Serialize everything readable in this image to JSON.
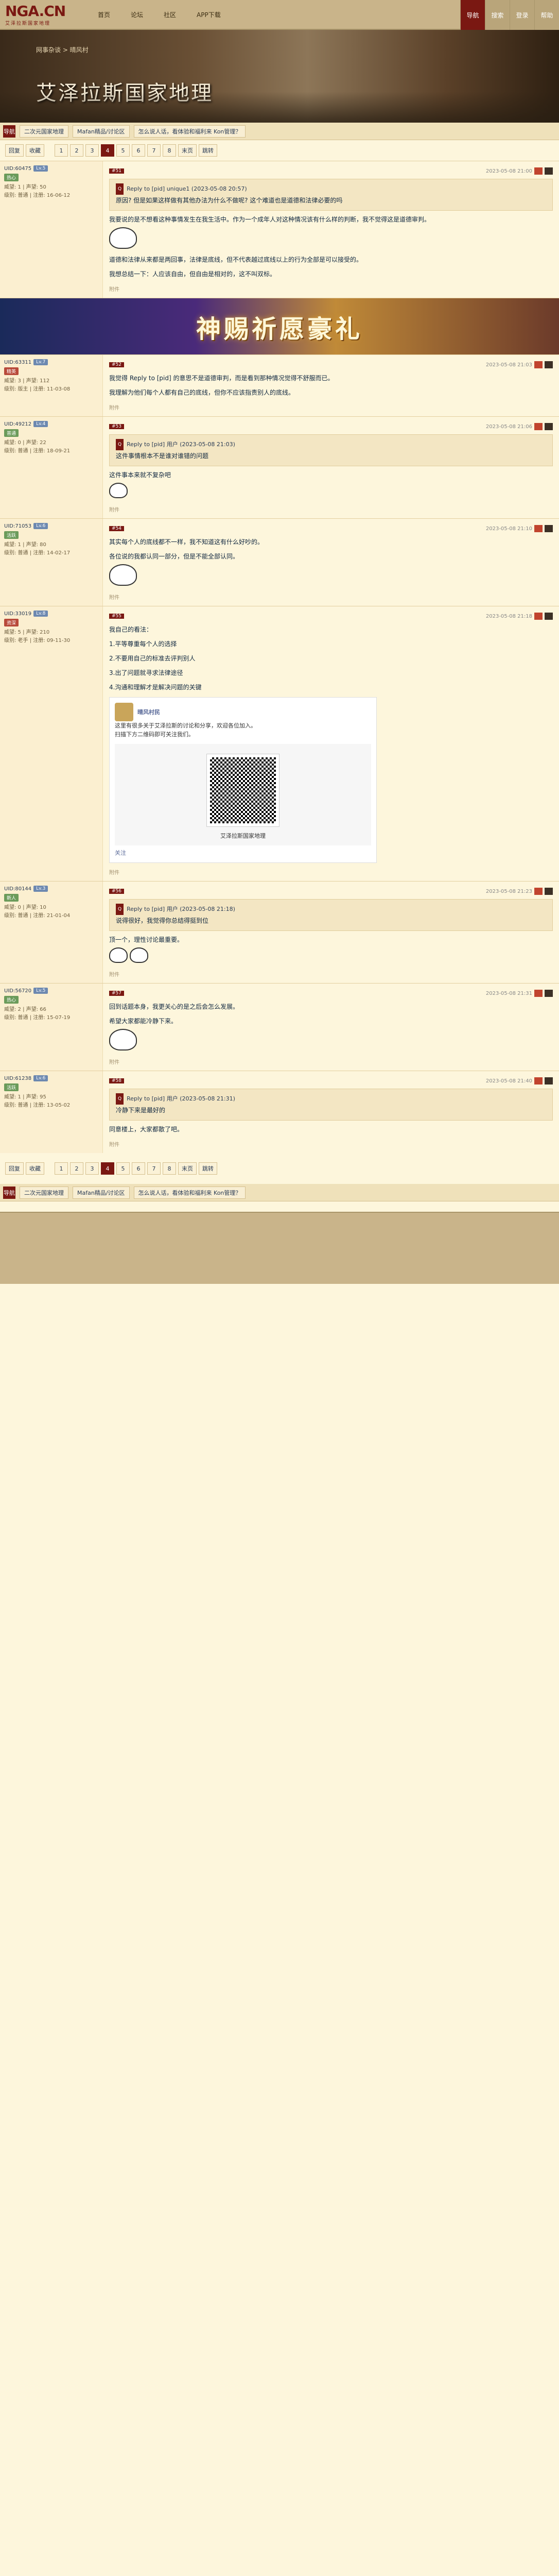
{
  "top": {
    "logo": "NGA.CN",
    "logo_sub": "艾泽拉斯国家地理",
    "nav": [
      "首页",
      "论坛",
      "社区",
      "APP下载"
    ],
    "right": [
      "导航",
      "搜索",
      "登录",
      "帮助"
    ]
  },
  "banner": {
    "title": "艾泽拉斯国家地理",
    "crumb": "网事杂谈 > 晴风村"
  },
  "subnav": {
    "icon": "导航",
    "tags": [
      "二次元国家地理",
      "Mafan精品/讨论区",
      "怎么说人话，看体验和福利来 Kon管理？"
    ]
  },
  "pager": {
    "left": [
      "回复",
      "收藏"
    ],
    "pages": [
      "1",
      "2",
      "3",
      "4",
      "5",
      "6",
      "7",
      "8"
    ],
    "current": "4",
    "right": [
      "末页",
      "跳转"
    ]
  },
  "posts": [
    {
      "uid": "UID:60475",
      "level": "Lv.5",
      "badge": "热心",
      "stats": [
        "威望: 1 | 声望: 50",
        "级别: 普通 | 注册: 16-06-12"
      ],
      "floor": "#51",
      "time": "2023-05-08 21:00",
      "quote_author": "Reply to [pid] unique1 (2023-05-08 20:57)",
      "quote": "原因? 但是如果这样做有其他办法为什么不做呢? 这个难道也是道德和法律必要的吗",
      "text": [
        "我要说的是不想看这种事情发生在我生活中。作为一个成年人对这种情况该有什么样的判断，我不觉得这是道德审判。",
        "道德和法律从来都是两回事，法律是底线，但不代表越过底线以上的行为全部是可以接受的。",
        "我想总结一下：人应该自由，但自由是相对的，这不叫双标。"
      ],
      "tag": "附件"
    },
    {
      "uid": "UID:63311",
      "level": "Lv.7",
      "badge": "精英",
      "stats": [
        "威望: 3 | 声望: 112",
        "级别: 版主 | 注册: 11-03-08"
      ],
      "floor": "#52",
      "time": "2023-05-08 21:03",
      "text": [
        "我觉得 Reply to [pid] 的意思不是道德审判，而是看到那种情况觉得不舒服而已。",
        "我理解为他们每个人都有自己的底线，但你不应该指责别人的底线。"
      ],
      "tag": "附件"
    },
    {
      "uid": "UID:49212",
      "level": "Lv.4",
      "badge": "普通",
      "stats": [
        "威望: 0 | 声望: 22",
        "级别: 普通 | 注册: 18-09-21"
      ],
      "floor": "#53",
      "time": "2023-05-08 21:06",
      "quote_author": "Reply to [pid] 用户 (2023-05-08 21:03)",
      "quote": "这件事情根本不是谁对谁错的问题",
      "text": [
        "这件事本来就不复杂吧"
      ],
      "tag": "附件"
    },
    {
      "uid": "UID:71053",
      "level": "Lv.6",
      "badge": "活跃",
      "stats": [
        "威望: 1 | 声望: 80",
        "级别: 普通 | 注册: 14-02-17"
      ],
      "floor": "#54",
      "time": "2023-05-08 21:10",
      "text": [
        "其实每个人的底线都不一样，我不知道这有什么好吵的。",
        "各位说的我都认同一部分，但是不能全部认同。"
      ],
      "tag": "附件"
    },
    {
      "uid": "UID:33019",
      "level": "Lv.8",
      "badge": "资深",
      "stats": [
        "威望: 5 | 声望: 210",
        "级别: 老手 | 注册: 09-11-30"
      ],
      "floor": "#55",
      "time": "2023-05-08 21:18",
      "text": [
        "我自己的看法：",
        "1.平等尊重每个人的选择",
        "2.不要用自己的标准去评判别人",
        "3.出了问题就寻求法律途径",
        "4.沟通和理解才是解决问题的关键"
      ],
      "wechat": {
        "name": "晴风村民",
        "lines": [
          "这里有很多关于艾泽拉斯的讨论和分享，欢迎各位加入。",
          "扫描下方二维码即可关注我们。"
        ],
        "caption": "艾泽拉斯国家地理",
        "button": "关注"
      },
      "tag": "附件"
    },
    {
      "uid": "UID:80144",
      "level": "Lv.3",
      "badge": "新人",
      "stats": [
        "威望: 0 | 声望: 10",
        "级别: 普通 | 注册: 21-01-04"
      ],
      "floor": "#56",
      "time": "2023-05-08 21:23",
      "quote_author": "Reply to [pid] 用户 (2023-05-08 21:18)",
      "quote": "说得很好，我觉得你总结得挺到位",
      "text": [
        "顶一个，理性讨论最重要。"
      ],
      "tag": "附件"
    },
    {
      "uid": "UID:56720",
      "level": "Lv.5",
      "badge": "热心",
      "stats": [
        "威望: 2 | 声望: 66",
        "级别: 普通 | 注册: 15-07-19"
      ],
      "floor": "#57",
      "time": "2023-05-08 21:31",
      "text": [
        "回到话题本身，我更关心的是之后会怎么发展。",
        "希望大家都能冷静下来。"
      ],
      "tag": "附件"
    },
    {
      "uid": "UID:61238",
      "level": "Lv.6",
      "badge": "活跃",
      "stats": [
        "威望: 1 | 声望: 95",
        "级别: 普通 | 注册: 13-05-02"
      ],
      "floor": "#58",
      "time": "2023-05-08 21:40",
      "quote_author": "Reply to [pid] 用户 (2023-05-08 21:31)",
      "quote": "冷静下来是最好的",
      "text": [
        "同意楼上，大家都散了吧。"
      ],
      "tag": "附件"
    }
  ],
  "ad": {
    "text": "神赐祈愿豪礼"
  }
}
